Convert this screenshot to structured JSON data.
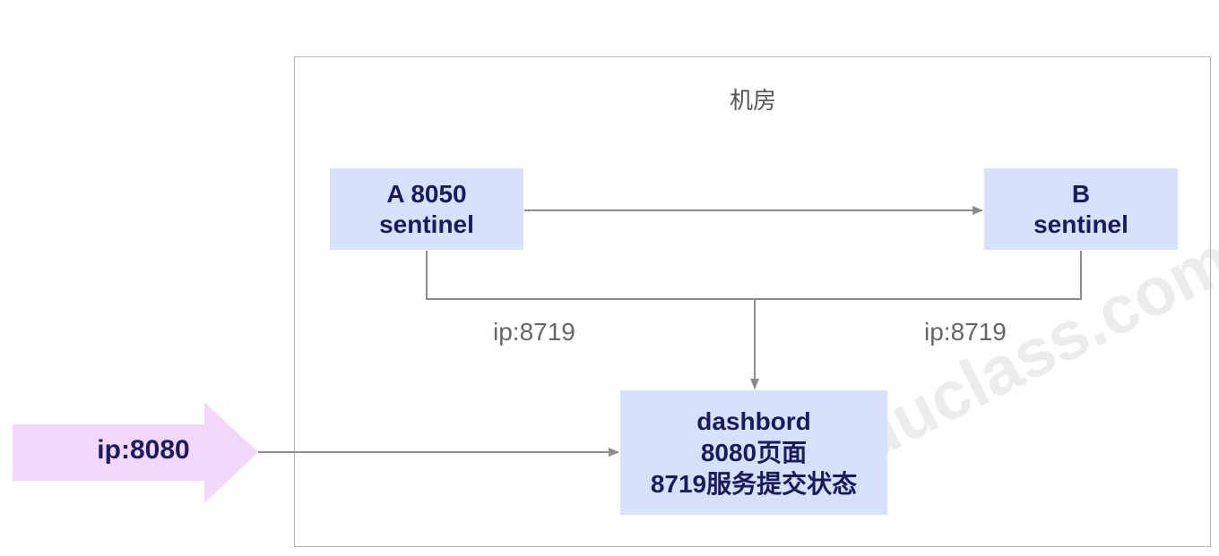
{
  "room": {
    "title": "机房"
  },
  "nodes": {
    "a": {
      "line1": "A 8050",
      "line2": "sentinel"
    },
    "b": {
      "line1": "B",
      "line2": "sentinel"
    },
    "dashboard": {
      "line1": "dashbord",
      "line2": "8080页面",
      "line3": "8719服务提交状态"
    }
  },
  "ports": {
    "a": "ip:8719",
    "b": "ip:8719"
  },
  "entry": {
    "label": "ip:8080"
  },
  "watermark": {
    "text": "yduclass.com"
  },
  "colors": {
    "node_fill": "#d6e2fb",
    "entry_arrow_fill": "#f2d7f8",
    "wire": "#8c8c8c",
    "text_dark": "#1a1a5c"
  }
}
